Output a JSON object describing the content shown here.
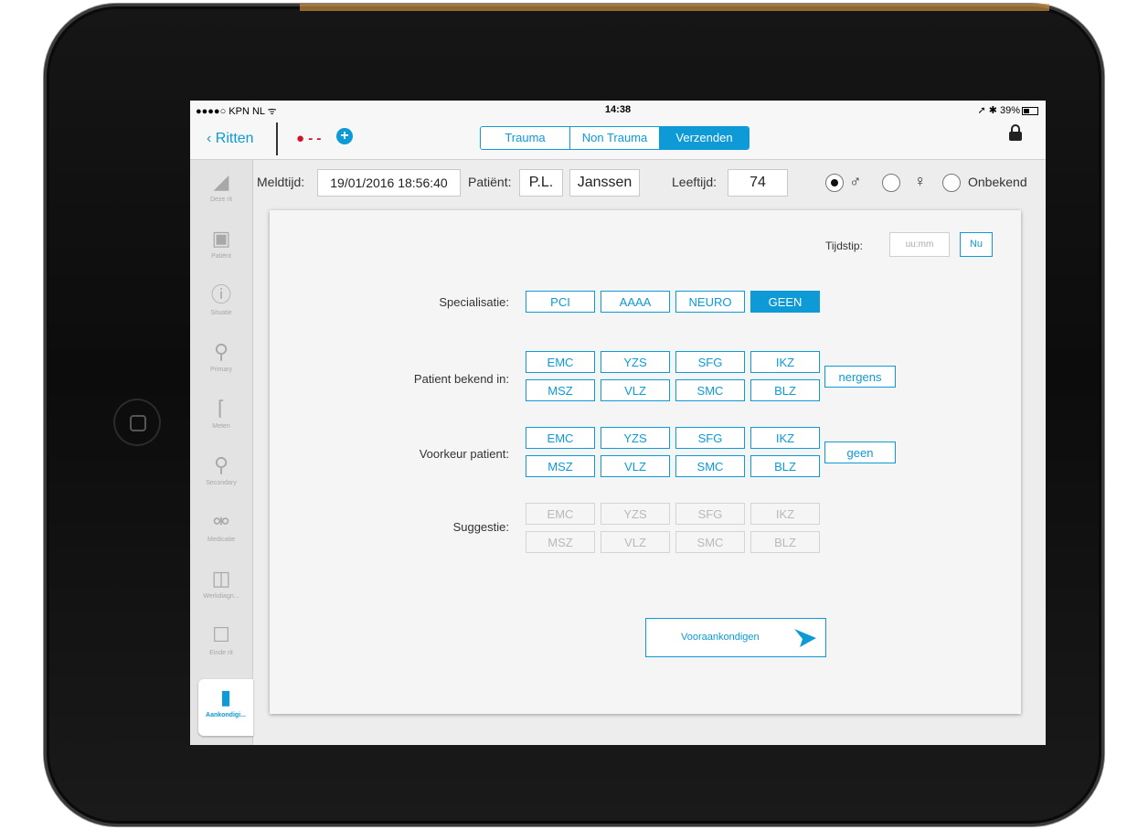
{
  "status_bar": {
    "carrier": "●●●●○ KPN NL ᯤ",
    "time": "14:38",
    "right": "➚ ✱ 39%"
  },
  "nav": {
    "back_label": "Ritten",
    "patient_indicator": "- -",
    "lock_icon": "lock-icon",
    "tabs": [
      {
        "label": "Trauma"
      },
      {
        "label": "Non Trauma"
      },
      {
        "label": "Verzenden"
      }
    ],
    "active_tab": "Verzenden"
  },
  "sidebar": {
    "items": [
      {
        "label": "Deze rit",
        "icon": "tag-icon"
      },
      {
        "label": "Patiënt",
        "icon": "id-card-icon"
      },
      {
        "label": "Situatie",
        "icon": "alert-icon"
      },
      {
        "label": "Primary",
        "icon": "search-icon"
      },
      {
        "label": "Meten",
        "icon": "thermometer-icon"
      },
      {
        "label": "Secondary",
        "icon": "search-icon"
      },
      {
        "label": "Medicatie",
        "icon": "pill-icon"
      },
      {
        "label": "Werkdiagn...",
        "icon": "medkit-icon"
      },
      {
        "label": "Einde rit",
        "icon": "clipboard-icon"
      },
      {
        "label": "Aankondigi...",
        "icon": "megaphone-icon"
      }
    ],
    "active": "Aankondigi..."
  },
  "header_fields": {
    "meldtijd_label": "Meldtijd:",
    "meldtijd_value": "19/01/2016 18:56:40",
    "patient_label": "Patiënt:",
    "patient_initials": "P.L.",
    "patient_name": "Janssen",
    "age_label": "Leeftijd:",
    "age_value": "74",
    "gender_options": [
      "♂",
      "♀",
      "Onbekend"
    ],
    "gender_selected": "♂"
  },
  "card": {
    "tijdstip_label": "Tijdstip:",
    "tijdstip_placeholder": "uu:mm",
    "nu_label": "Nu",
    "specialisatie": {
      "label": "Specialisatie:",
      "options": [
        "PCI",
        "AAAA",
        "NEURO",
        "GEEN"
      ],
      "selected": "GEEN"
    },
    "patient_bekend": {
      "label": "Patient bekend in:",
      "row1": [
        "EMC",
        "YZS",
        "SFG",
        "IKZ"
      ],
      "row2": [
        "MSZ",
        "VLZ",
        "SMC",
        "BLZ"
      ],
      "extra": "nergens"
    },
    "voorkeur": {
      "label": "Voorkeur patient:",
      "row1": [
        "EMC",
        "YZS",
        "SFG",
        "IKZ"
      ],
      "row2": [
        "MSZ",
        "VLZ",
        "SMC",
        "BLZ"
      ],
      "extra": "geen"
    },
    "suggestie": {
      "label": "Suggestie:",
      "row1": [
        "EMC",
        "YZS",
        "SFG",
        "IKZ"
      ],
      "row2": [
        "MSZ",
        "VLZ",
        "SMC",
        "BLZ"
      ]
    },
    "send_label": "Vooraankondigen"
  },
  "colors": {
    "accent": "#0d9ad6",
    "patient_red": "#d2102a"
  }
}
